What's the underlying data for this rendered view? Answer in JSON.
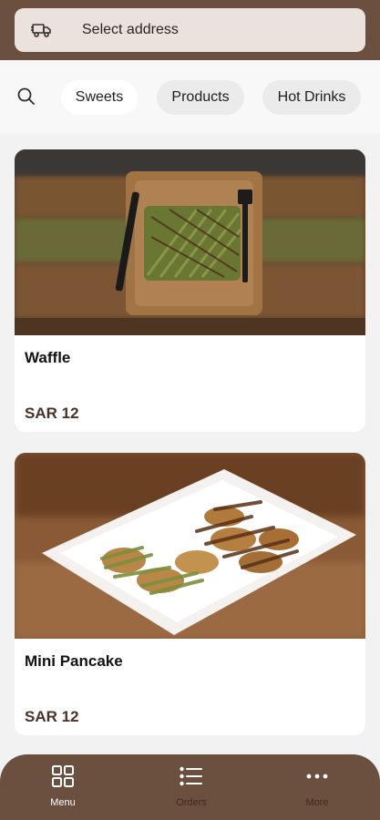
{
  "header": {
    "address_label": "Select address",
    "address_icon": "delivery-truck-icon"
  },
  "filters": {
    "search_icon": "search-icon",
    "categories": [
      {
        "label": "Sweets",
        "active": true
      },
      {
        "label": "Products",
        "active": false
      },
      {
        "label": "Hot Drinks",
        "active": false
      }
    ]
  },
  "products": [
    {
      "name": "Waffle",
      "price": "SAR 12",
      "image": "waffle-photo"
    },
    {
      "name": "Mini Pancake",
      "price": "SAR 12",
      "image": "mini-pancake-photo"
    }
  ],
  "bottom_nav": {
    "items": [
      {
        "label": "Menu",
        "icon": "grid-icon",
        "active": true
      },
      {
        "label": "Orders",
        "icon": "list-icon",
        "active": false
      },
      {
        "label": "More",
        "icon": "more-dots-icon",
        "active": false
      }
    ]
  },
  "colors": {
    "brand_brown": "#6b4f3f",
    "price_brown": "#4a3226",
    "pill_beige": "#e9e2dd"
  }
}
